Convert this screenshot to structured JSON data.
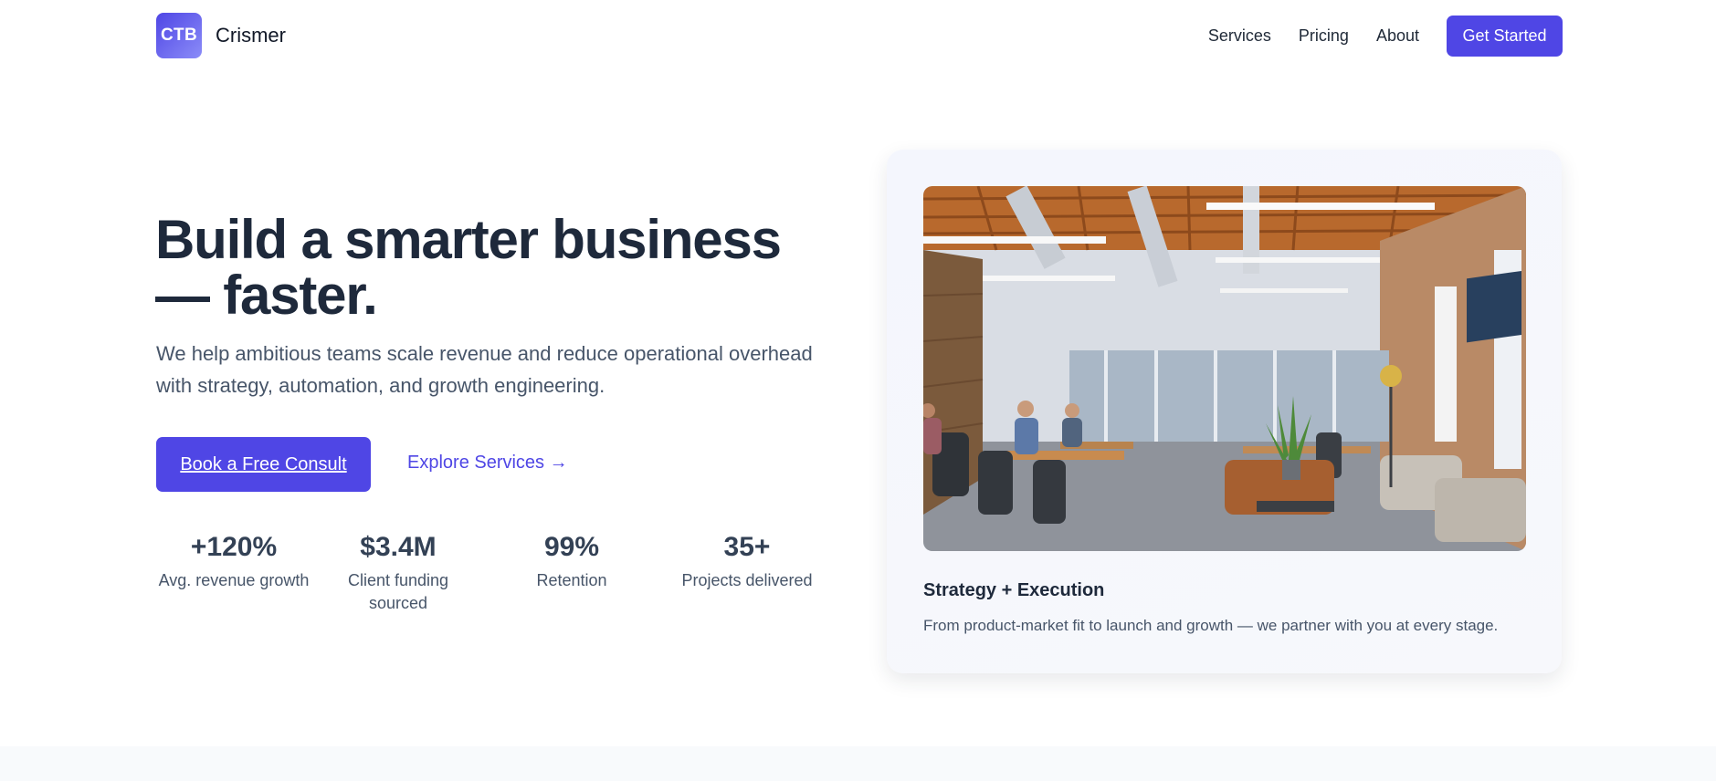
{
  "brand": {
    "logo_text": "CTB",
    "name": "Crismer"
  },
  "nav": {
    "items": [
      "Services",
      "Pricing",
      "About"
    ],
    "cta": "Get Started"
  },
  "hero": {
    "title": "Build a smarter business — faster.",
    "subtitle": "We help ambitious teams scale revenue and reduce operational overhead with strategy, automation, and growth engineering.",
    "primary_button": "Book a Free Consult",
    "secondary_link": "Explore Services →",
    "stats": [
      {
        "value": "+120%",
        "label": "Avg. revenue growth"
      },
      {
        "value": "$3.4M",
        "label": "Client funding sourced"
      },
      {
        "value": "99%",
        "label": "Retention"
      },
      {
        "value": "35+",
        "label": "Projects delivered"
      }
    ]
  },
  "card": {
    "title": "Strategy + Execution",
    "text": "From product-market fit to launch and growth — we partner with you at every stage."
  },
  "colors": {
    "accent": "#4f46e5",
    "heading": "#1e293b",
    "body": "#475569"
  }
}
